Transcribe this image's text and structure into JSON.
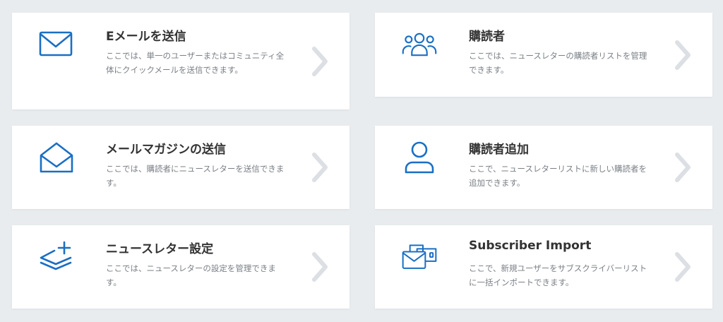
{
  "colors": {
    "accent": "#1a6fc4",
    "chevron": "#dcdfe3",
    "title": "#333333",
    "desc": "#7a7f85",
    "background": "#e9ecef"
  },
  "cards": [
    {
      "title": "Eメールを送信",
      "description": "ここでは、単一のユーザーまたはコミュニティ全体にクイックメールを送信できます。",
      "icon": "envelope-icon"
    },
    {
      "title": "購読者",
      "description": "ここでは、ニュースレターの購読者リストを管理できます。",
      "icon": "users-group-icon"
    },
    {
      "title": "メールマガジンの送信",
      "description": "ここでは、購読者にニュースレターを送信できます。",
      "icon": "open-envelope-icon"
    },
    {
      "title": "購読者追加",
      "description": "ここで、ニュースレターリストに新しい購読者を追加できます。",
      "icon": "user-icon"
    },
    {
      "title": "ニュースレター設定",
      "description": "ここでは、ニュースレターの設定を管理できます。",
      "icon": "layers-plus-icon"
    },
    {
      "title": "Subscriber Import",
      "description": "ここで、新規ユーザーをサブスクライバーリストに一括インポートできます。",
      "icon": "envelope-import-icon"
    }
  ]
}
